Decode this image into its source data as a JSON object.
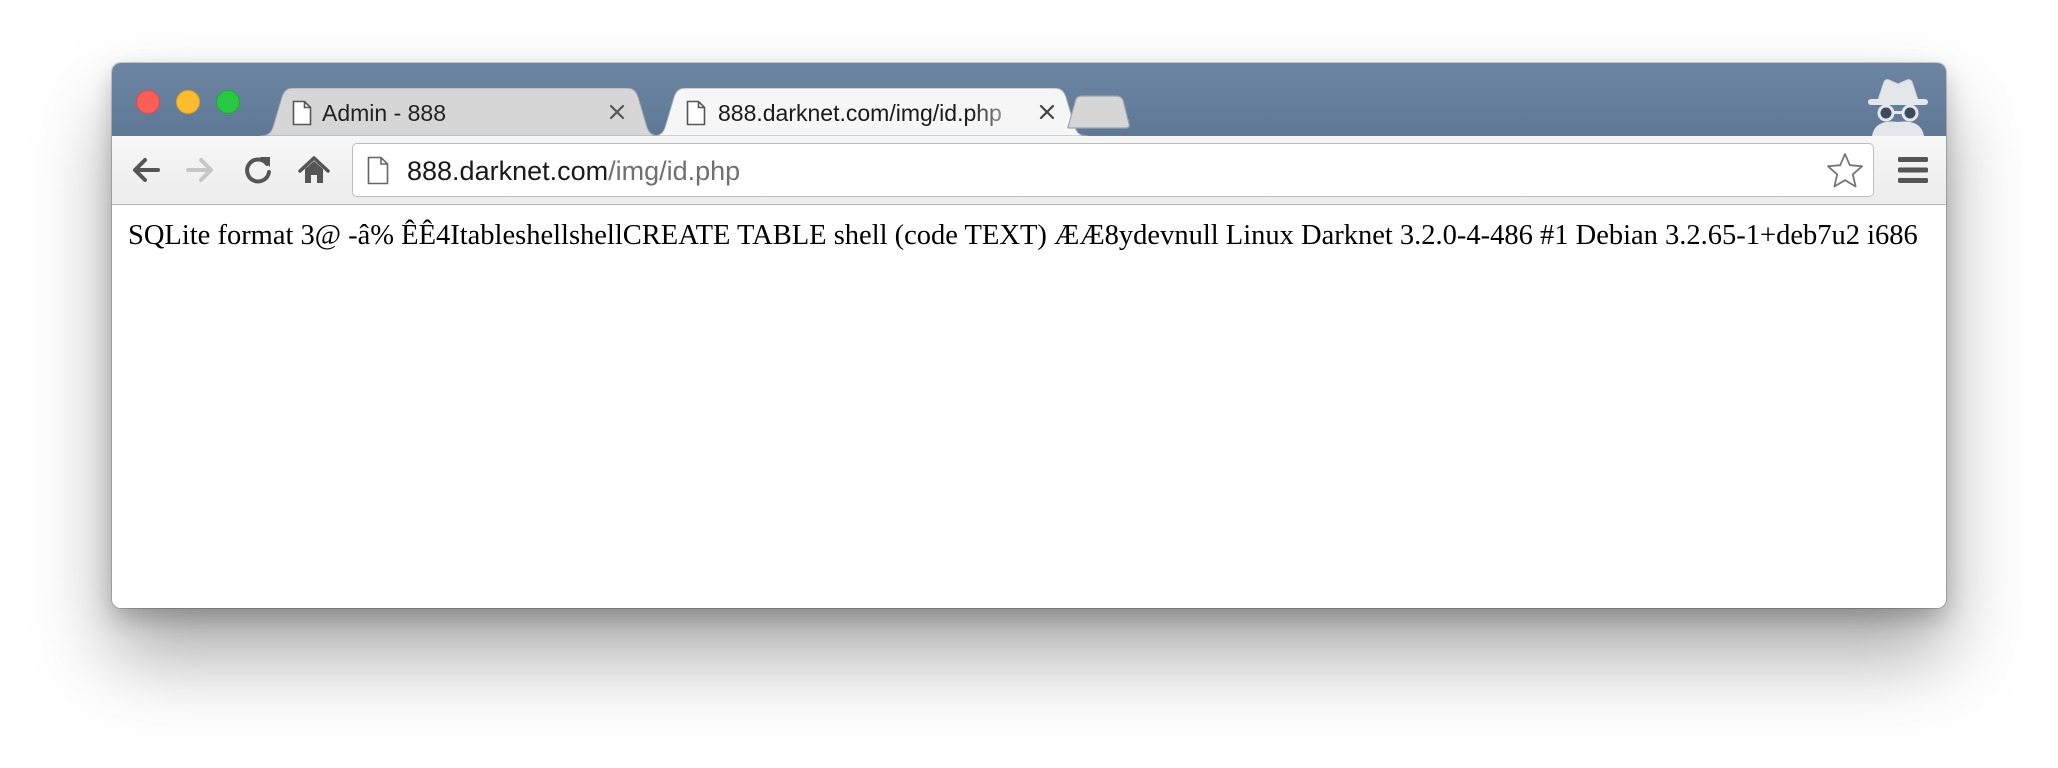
{
  "window": {
    "controls": [
      "close",
      "minimize",
      "zoom"
    ]
  },
  "tabs": [
    {
      "title": "Admin - 888",
      "active": false,
      "icon": "document-icon",
      "close_icon": "close-icon"
    },
    {
      "title": "888.darknet.com/img/id.php",
      "active": true,
      "icon": "document-icon",
      "close_icon": "close-icon"
    }
  ],
  "browser_mode": {
    "icon": "incognito-icon"
  },
  "toolbar": {
    "back_icon": "arrow-left-icon",
    "forward_icon": "arrow-right-icon",
    "reload_icon": "reload-icon",
    "home_icon": "home-icon",
    "menu_icon": "hamburger-menu-icon"
  },
  "address_bar": {
    "host": "888.darknet.com",
    "path": "/img/id.php",
    "bookmark_icon": "star-icon"
  },
  "page": {
    "text": "SQLite format 3@ -â% ÊÊ4ItableshellshellCREATE TABLE shell (code TEXT) ÆÆ8ydevnull Linux Darknet 3.2.0-4-486 #1 Debian 3.2.65-1+deb7u2 i686"
  },
  "colors": {
    "titlebar": "#6a83a1",
    "tab_active": "#f6f6f6",
    "tab_inactive": "#d5d5d5",
    "toolbar": "#f2f2f2",
    "url_host": "#1a1a1a",
    "url_path": "#707070"
  }
}
